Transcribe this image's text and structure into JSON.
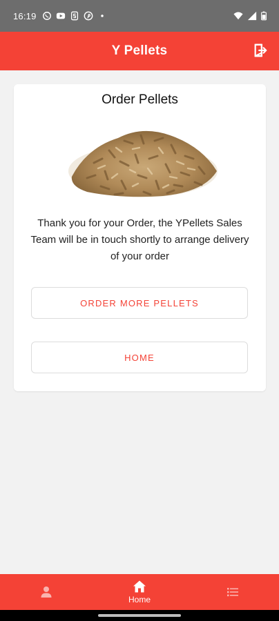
{
  "status_bar": {
    "time": "16:19",
    "left_icons": [
      "whatsapp-icon",
      "youtube-icon",
      "app-s-icon",
      "pinterest-icon",
      "dot-icon"
    ],
    "right_icons": [
      "wifi-icon",
      "signal-icon",
      "battery-icon"
    ]
  },
  "header": {
    "title": "Y Pellets",
    "logout_icon": "logout-icon",
    "color": "#f44236"
  },
  "card": {
    "title": "Order Pellets",
    "image": "wood-pellets-pile",
    "message": "Thank you for your Order, the YPellets Sales Team will be in touch shortly to arrange delivery of your order",
    "buttons": {
      "order_more": "ORDER MORE PELLETS",
      "home": "HOME"
    }
  },
  "bottom_nav": {
    "items": [
      {
        "icon": "person-icon",
        "label": ""
      },
      {
        "icon": "home-icon",
        "label": "Home"
      },
      {
        "icon": "list-icon",
        "label": ""
      }
    ]
  }
}
